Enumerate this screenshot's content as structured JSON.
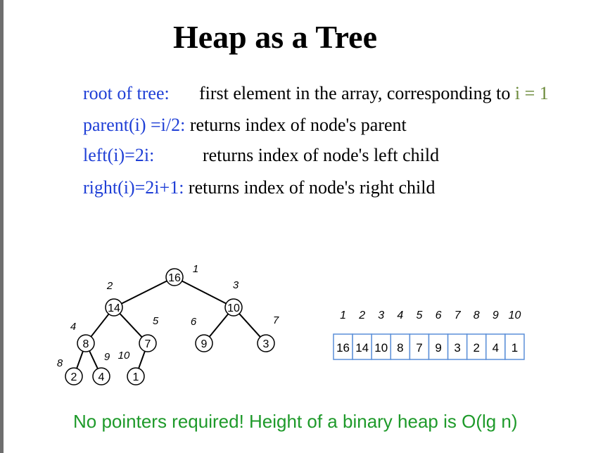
{
  "slide": {
    "title": "Heap as a Tree",
    "definitions": [
      {
        "term": "root of tree:",
        "desc": "first element in the array, corresponding to ",
        "highlight": "i = 1"
      },
      {
        "term": "parent(i) =i/2:",
        "desc": "returns index of node's parent"
      },
      {
        "term": "left(i)=2i:",
        "desc": "returns index of node's left child"
      },
      {
        "term": "right(i)=2i+1:",
        "desc": "returns index of node's right child"
      }
    ],
    "footer": "No pointers required!  Height of a binary heap is O(lg n)"
  },
  "tree": {
    "nodes": [
      {
        "index": "1",
        "value": "16"
      },
      {
        "index": "2",
        "value": "14"
      },
      {
        "index": "3",
        "value": "10"
      },
      {
        "index": "4",
        "value": "8"
      },
      {
        "index": "5",
        "value": "7"
      },
      {
        "index": "6",
        "value": "9"
      },
      {
        "index": "7",
        "value": "3"
      },
      {
        "index": "8",
        "value": "2"
      },
      {
        "index": "9",
        "value": "4"
      },
      {
        "index": "10",
        "value": "1"
      }
    ]
  },
  "array": {
    "indices": [
      "1",
      "2",
      "3",
      "4",
      "5",
      "6",
      "7",
      "8",
      "9",
      "10"
    ],
    "values": [
      "16",
      "14",
      "10",
      "8",
      "7",
      "9",
      "3",
      "2",
      "4",
      "1"
    ]
  },
  "colors": {
    "term": "#1f3fd6",
    "highlight": "#6b8a3a",
    "footer": "#1e9a2a",
    "array_border": "#5b8fd8"
  }
}
